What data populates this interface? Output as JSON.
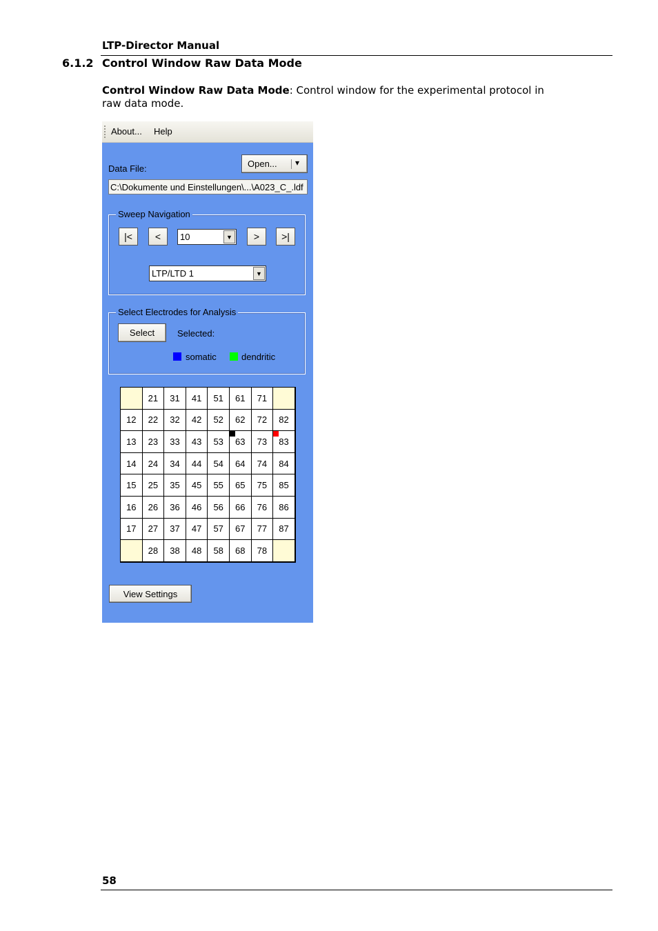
{
  "doc": {
    "header_title": "LTP-Director Manual",
    "section_number": "6.1.2",
    "section_title": "Control Window Raw Data Mode",
    "caption_bold": "Control Window Raw Data Mode",
    "caption_rest": ": Control window for the experimental protocol in raw data mode.",
    "page_number": "58"
  },
  "window": {
    "menu": [
      "About...",
      "Help"
    ],
    "data_file_label": "Data File:",
    "open_button": "Open...",
    "open_dropdown_glyph": "▾",
    "data_file_path": "C:\\Dokumente und Einstellungen\\...\\A023_C_.ldf",
    "sweep_group_title": "Sweep Navigation",
    "nav_first": "|<",
    "nav_prev": "<",
    "sweep_value": "10",
    "nav_next": ">",
    "nav_last": ">|",
    "protocol_value": "LTP/LTD 1",
    "combo_arrow_glyph": "▼",
    "electrode_group_title": "Select Electrodes for Analysis",
    "select_button": "Select",
    "selected_label": "Selected:",
    "legend": [
      {
        "label": "somatic",
        "color": "#0000ff"
      },
      {
        "label": "dendritic",
        "color": "#00ff00"
      }
    ],
    "view_settings_button": "View Settings",
    "electrode_grid": [
      [
        "",
        "21",
        "31",
        "41",
        "51",
        "61",
        "71",
        ""
      ],
      [
        "12",
        "22",
        "32",
        "42",
        "52",
        "62",
        "72",
        "82"
      ],
      [
        "13",
        "23",
        "33",
        "43",
        "53",
        "63",
        "73",
        "83"
      ],
      [
        "14",
        "24",
        "34",
        "44",
        "54",
        "64",
        "74",
        "84"
      ],
      [
        "15",
        "25",
        "35",
        "45",
        "55",
        "65",
        "75",
        "85"
      ],
      [
        "16",
        "26",
        "36",
        "46",
        "56",
        "66",
        "76",
        "86"
      ],
      [
        "17",
        "27",
        "37",
        "47",
        "57",
        "67",
        "77",
        "87"
      ],
      [
        "",
        "28",
        "38",
        "48",
        "58",
        "68",
        "78",
        ""
      ]
    ],
    "markers": [
      {
        "electrode": "63",
        "color": "#000000"
      },
      {
        "electrode": "83",
        "color": "#ff0000"
      }
    ]
  }
}
